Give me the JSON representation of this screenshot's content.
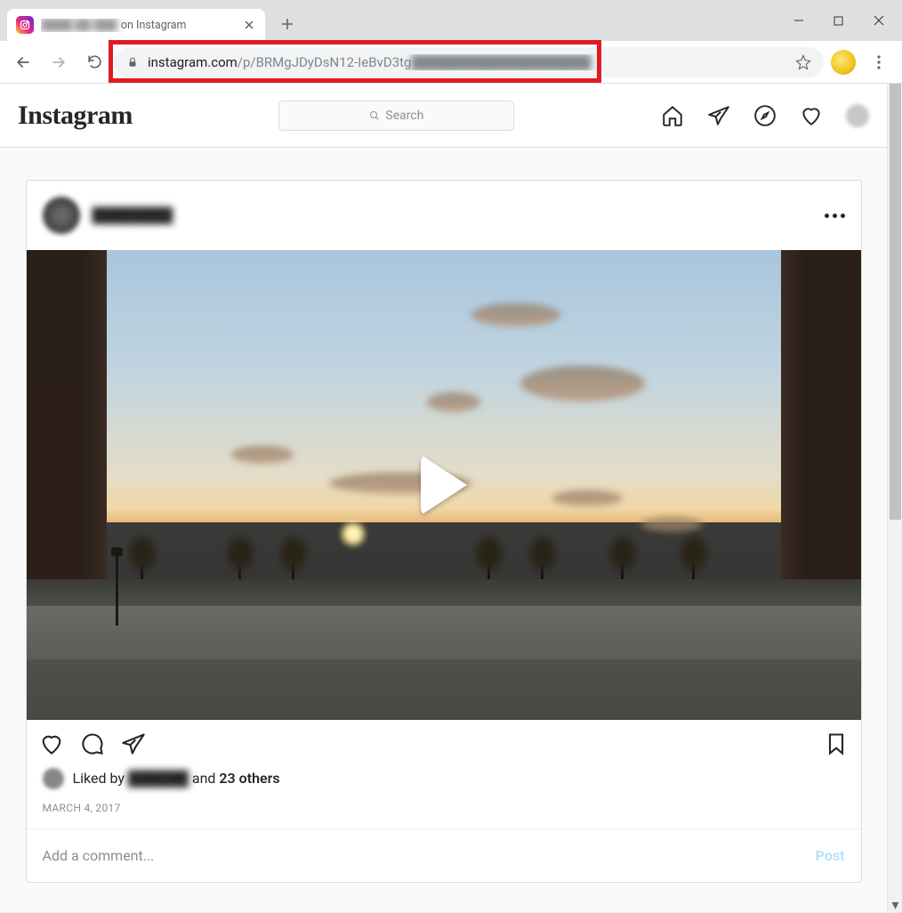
{
  "browser": {
    "tab_title_suffix": "on Instagram",
    "url_visible": "instagram.com",
    "url_path": "/p/BRMgJDyDsN12-IeBvD3tg"
  },
  "ig_header": {
    "logo_text": "Instagram",
    "search_placeholder": "Search"
  },
  "post": {
    "likes_prefix": "Liked by",
    "likes_and": "and",
    "likes_others": "23 others",
    "date": "MARCH 4, 2017",
    "comment_placeholder": "Add a comment...",
    "post_button": "Post"
  }
}
